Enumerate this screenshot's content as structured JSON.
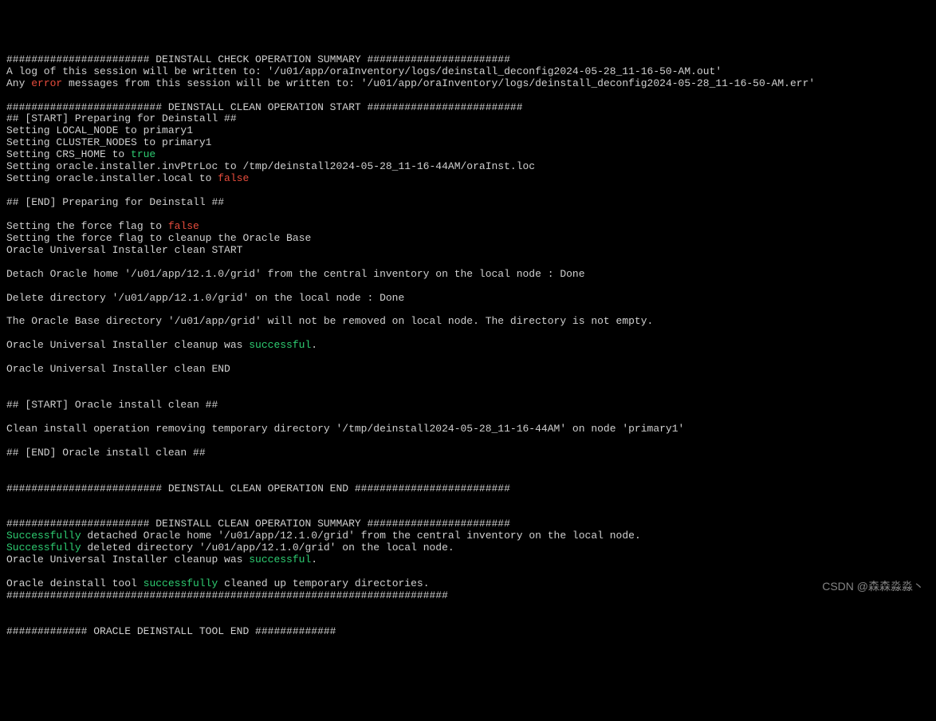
{
  "lines": {
    "l1": "####################### DEINSTALL CHECK OPERATION SUMMARY #######################",
    "l2": "A log of this session will be written to: '/u01/app/oraInventory/logs/deinstall_deconfig2024-05-28_11-16-50-AM.out'",
    "l3a": "Any ",
    "l3_error": "error",
    "l3b": " messages from this session will be written to: '/u01/app/oraInventory/logs/deinstall_deconfig2024-05-28_11-16-50-AM.err'",
    "l4": "######################### DEINSTALL CLEAN OPERATION START #########################",
    "l5": "## [START] Preparing for Deinstall ##",
    "l6": "Setting LOCAL_NODE to primary1",
    "l7": "Setting CLUSTER_NODES to primary1",
    "l8a": "Setting CRS_HOME to ",
    "l8_true": "true",
    "l9": "Setting oracle.installer.invPtrLoc to /tmp/deinstall2024-05-28_11-16-44AM/oraInst.loc",
    "l10a": "Setting oracle.installer.local to ",
    "l10_false": "false",
    "l11": "## [END] Preparing for Deinstall ##",
    "l12a": "Setting the force flag to ",
    "l12_false": "false",
    "l13": "Setting the force flag to cleanup the Oracle Base",
    "l14": "Oracle Universal Installer clean START",
    "l15": "Detach Oracle home '/u01/app/12.1.0/grid' from the central inventory on the local node : Done",
    "l16": "Delete directory '/u01/app/12.1.0/grid' on the local node : Done",
    "l17": "The Oracle Base directory '/u01/app/grid' will not be removed on local node. The directory is not empty.",
    "l18a": "Oracle Universal Installer cleanup was ",
    "l18_successful": "successful",
    "l18b": ".",
    "l19": "Oracle Universal Installer clean END",
    "l20": "## [START] Oracle install clean ##",
    "l21": "Clean install operation removing temporary directory '/tmp/deinstall2024-05-28_11-16-44AM' on node 'primary1'",
    "l22": "## [END] Oracle install clean ##",
    "l23": "######################### DEINSTALL CLEAN OPERATION END #########################",
    "l24": "####################### DEINSTALL CLEAN OPERATION SUMMARY #######################",
    "l25_success": "Successfully",
    "l25b": " detached Oracle home '/u01/app/12.1.0/grid' from the central inventory on the local node.",
    "l26_success": "Successfully",
    "l26b": " deleted directory '/u01/app/12.1.0/grid' on the local node.",
    "l27a": "Oracle Universal Installer cleanup was ",
    "l27_successful": "successful",
    "l27b": ".",
    "l28a": "Oracle deinstall tool ",
    "l28_successfully": "successfully",
    "l28b": " cleaned up temporary directories.",
    "l29": "#######################################################################",
    "l30": "############# ORACLE DEINSTALL TOOL END #############"
  },
  "watermark": "CSDN @森森淼淼丶"
}
